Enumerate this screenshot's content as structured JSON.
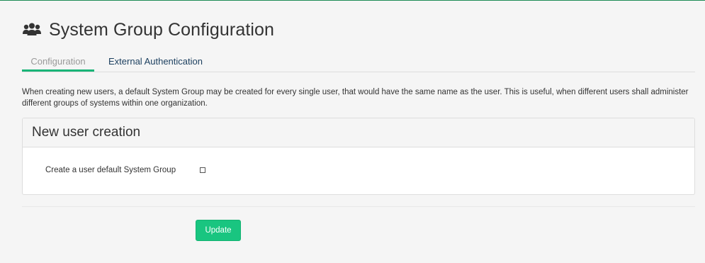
{
  "header": {
    "icon": "users-group-icon",
    "title": "System Group Configuration"
  },
  "tabs": [
    {
      "label": "Configuration",
      "active": true
    },
    {
      "label": "External Authentication",
      "active": false
    }
  ],
  "description": "When creating new users, a default System Group may be created for every single user, that would have the same name as the user. This is useful, when different users shall administer different groups of systems within one organization.",
  "panel": {
    "title": "New user creation",
    "field": {
      "label": "Create a user default System Group",
      "checked": false
    }
  },
  "actions": {
    "update_label": "Update"
  },
  "colors": {
    "accent": "#19b477",
    "button": "#19c580",
    "tab_link": "#1a3e5e"
  }
}
